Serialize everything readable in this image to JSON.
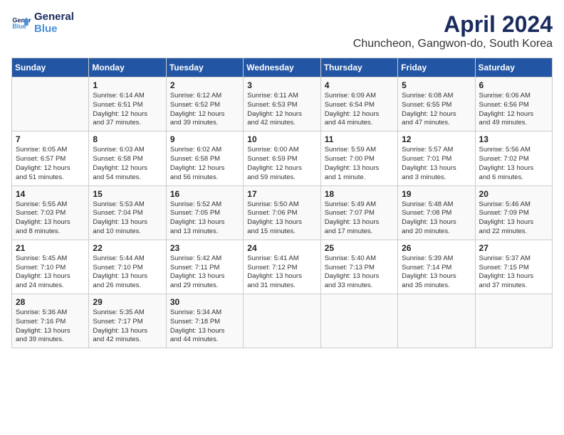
{
  "logo": {
    "line1": "General",
    "line2": "Blue"
  },
  "title": "April 2024",
  "subtitle": "Chuncheon, Gangwon-do, South Korea",
  "headers": [
    "Sunday",
    "Monday",
    "Tuesday",
    "Wednesday",
    "Thursday",
    "Friday",
    "Saturday"
  ],
  "weeks": [
    [
      {
        "day": "",
        "content": ""
      },
      {
        "day": "1",
        "content": "Sunrise: 6:14 AM\nSunset: 6:51 PM\nDaylight: 12 hours\nand 37 minutes."
      },
      {
        "day": "2",
        "content": "Sunrise: 6:12 AM\nSunset: 6:52 PM\nDaylight: 12 hours\nand 39 minutes."
      },
      {
        "day": "3",
        "content": "Sunrise: 6:11 AM\nSunset: 6:53 PM\nDaylight: 12 hours\nand 42 minutes."
      },
      {
        "day": "4",
        "content": "Sunrise: 6:09 AM\nSunset: 6:54 PM\nDaylight: 12 hours\nand 44 minutes."
      },
      {
        "day": "5",
        "content": "Sunrise: 6:08 AM\nSunset: 6:55 PM\nDaylight: 12 hours\nand 47 minutes."
      },
      {
        "day": "6",
        "content": "Sunrise: 6:06 AM\nSunset: 6:56 PM\nDaylight: 12 hours\nand 49 minutes."
      }
    ],
    [
      {
        "day": "7",
        "content": "Sunrise: 6:05 AM\nSunset: 6:57 PM\nDaylight: 12 hours\nand 51 minutes."
      },
      {
        "day": "8",
        "content": "Sunrise: 6:03 AM\nSunset: 6:58 PM\nDaylight: 12 hours\nand 54 minutes."
      },
      {
        "day": "9",
        "content": "Sunrise: 6:02 AM\nSunset: 6:58 PM\nDaylight: 12 hours\nand 56 minutes."
      },
      {
        "day": "10",
        "content": "Sunrise: 6:00 AM\nSunset: 6:59 PM\nDaylight: 12 hours\nand 59 minutes."
      },
      {
        "day": "11",
        "content": "Sunrise: 5:59 AM\nSunset: 7:00 PM\nDaylight: 13 hours\nand 1 minute."
      },
      {
        "day": "12",
        "content": "Sunrise: 5:57 AM\nSunset: 7:01 PM\nDaylight: 13 hours\nand 3 minutes."
      },
      {
        "day": "13",
        "content": "Sunrise: 5:56 AM\nSunset: 7:02 PM\nDaylight: 13 hours\nand 6 minutes."
      }
    ],
    [
      {
        "day": "14",
        "content": "Sunrise: 5:55 AM\nSunset: 7:03 PM\nDaylight: 13 hours\nand 8 minutes."
      },
      {
        "day": "15",
        "content": "Sunrise: 5:53 AM\nSunset: 7:04 PM\nDaylight: 13 hours\nand 10 minutes."
      },
      {
        "day": "16",
        "content": "Sunrise: 5:52 AM\nSunset: 7:05 PM\nDaylight: 13 hours\nand 13 minutes."
      },
      {
        "day": "17",
        "content": "Sunrise: 5:50 AM\nSunset: 7:06 PM\nDaylight: 13 hours\nand 15 minutes."
      },
      {
        "day": "18",
        "content": "Sunrise: 5:49 AM\nSunset: 7:07 PM\nDaylight: 13 hours\nand 17 minutes."
      },
      {
        "day": "19",
        "content": "Sunrise: 5:48 AM\nSunset: 7:08 PM\nDaylight: 13 hours\nand 20 minutes."
      },
      {
        "day": "20",
        "content": "Sunrise: 5:46 AM\nSunset: 7:09 PM\nDaylight: 13 hours\nand 22 minutes."
      }
    ],
    [
      {
        "day": "21",
        "content": "Sunrise: 5:45 AM\nSunset: 7:10 PM\nDaylight: 13 hours\nand 24 minutes."
      },
      {
        "day": "22",
        "content": "Sunrise: 5:44 AM\nSunset: 7:10 PM\nDaylight: 13 hours\nand 26 minutes."
      },
      {
        "day": "23",
        "content": "Sunrise: 5:42 AM\nSunset: 7:11 PM\nDaylight: 13 hours\nand 29 minutes."
      },
      {
        "day": "24",
        "content": "Sunrise: 5:41 AM\nSunset: 7:12 PM\nDaylight: 13 hours\nand 31 minutes."
      },
      {
        "day": "25",
        "content": "Sunrise: 5:40 AM\nSunset: 7:13 PM\nDaylight: 13 hours\nand 33 minutes."
      },
      {
        "day": "26",
        "content": "Sunrise: 5:39 AM\nSunset: 7:14 PM\nDaylight: 13 hours\nand 35 minutes."
      },
      {
        "day": "27",
        "content": "Sunrise: 5:37 AM\nSunset: 7:15 PM\nDaylight: 13 hours\nand 37 minutes."
      }
    ],
    [
      {
        "day": "28",
        "content": "Sunrise: 5:36 AM\nSunset: 7:16 PM\nDaylight: 13 hours\nand 39 minutes."
      },
      {
        "day": "29",
        "content": "Sunrise: 5:35 AM\nSunset: 7:17 PM\nDaylight: 13 hours\nand 42 minutes."
      },
      {
        "day": "30",
        "content": "Sunrise: 5:34 AM\nSunset: 7:18 PM\nDaylight: 13 hours\nand 44 minutes."
      },
      {
        "day": "",
        "content": ""
      },
      {
        "day": "",
        "content": ""
      },
      {
        "day": "",
        "content": ""
      },
      {
        "day": "",
        "content": ""
      }
    ]
  ]
}
